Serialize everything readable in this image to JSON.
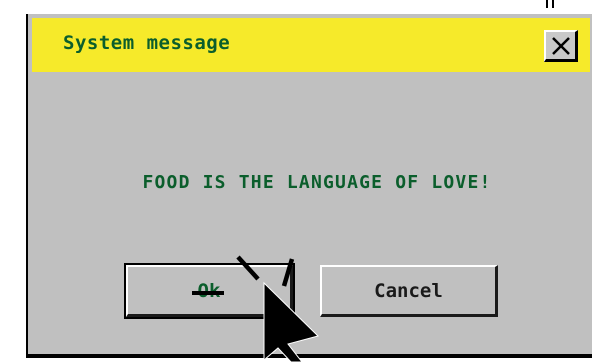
{
  "dialog": {
    "title": "System message",
    "close_icon": "close-x-icon",
    "message": "FOOD IS THE LANGUAGE OF LOVE!",
    "ok_label": "Ok",
    "cancel_label": "Cancel"
  },
  "colors": {
    "title_bar": "#f6ea2a",
    "text_green": "#0b5e2c",
    "dialog_bg": "#c0c0c0"
  },
  "cursor": {
    "icon": "mouse-pointer-arrow-icon",
    "effect": "click-burst-icon"
  }
}
